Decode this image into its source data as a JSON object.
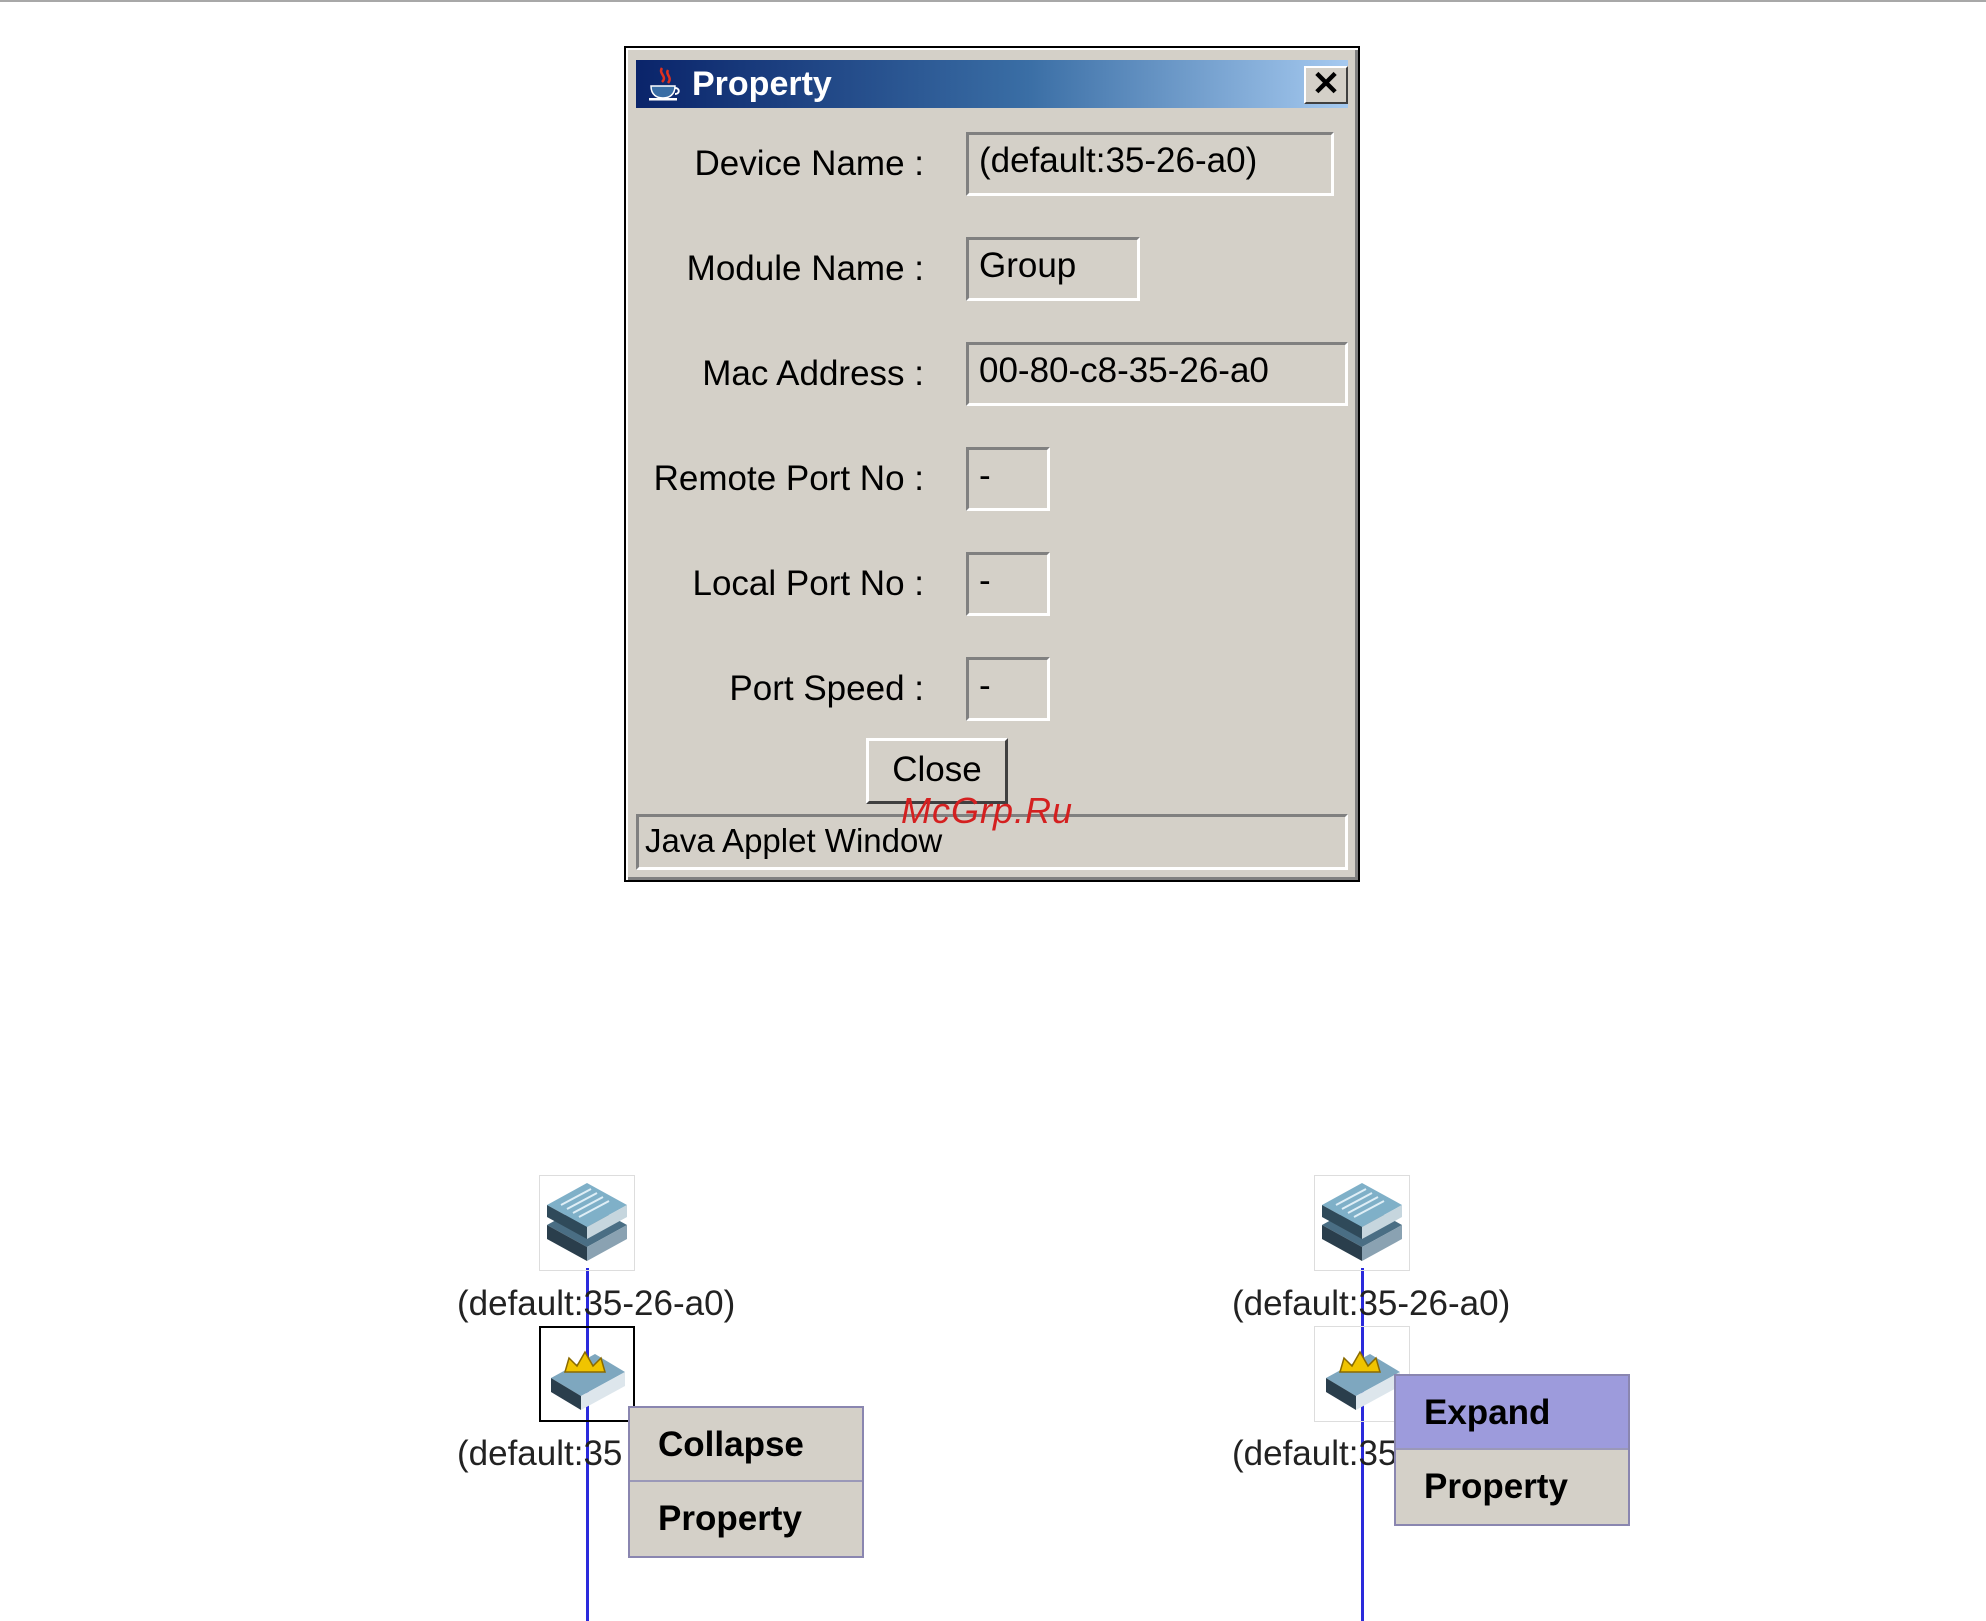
{
  "dialog": {
    "title": "Property",
    "close_x": "✕",
    "fields": [
      {
        "label": "Device Name :",
        "value": "(default:35-26-a0)"
      },
      {
        "label": "Module Name :",
        "value": "Group"
      },
      {
        "label": "Mac Address :",
        "value": "00-80-c8-35-26-a0"
      },
      {
        "label": "Remote Port No :",
        "value": "-"
      },
      {
        "label": "Local Port No :",
        "value": "-"
      },
      {
        "label": "Port Speed :",
        "value": "-"
      }
    ],
    "close_button": "Close",
    "status_text": "Java Applet Window"
  },
  "watermark": "McGrp.Ru",
  "left_panel": {
    "device_label": "(default:35-26-a0)",
    "group_label": "(default:35",
    "menu": [
      "Collapse",
      "Property"
    ]
  },
  "right_panel": {
    "device_label": "(default:35-26-a0)",
    "group_label": "(default:35",
    "menu": [
      "Expand",
      "Property"
    ],
    "highlighted": "Expand"
  },
  "colors": {
    "titlebar_start": "#0a246a",
    "titlebar_end": "#a6caf0",
    "link_line": "#2a2adc",
    "menu_highlight": "#9d9bdc"
  }
}
